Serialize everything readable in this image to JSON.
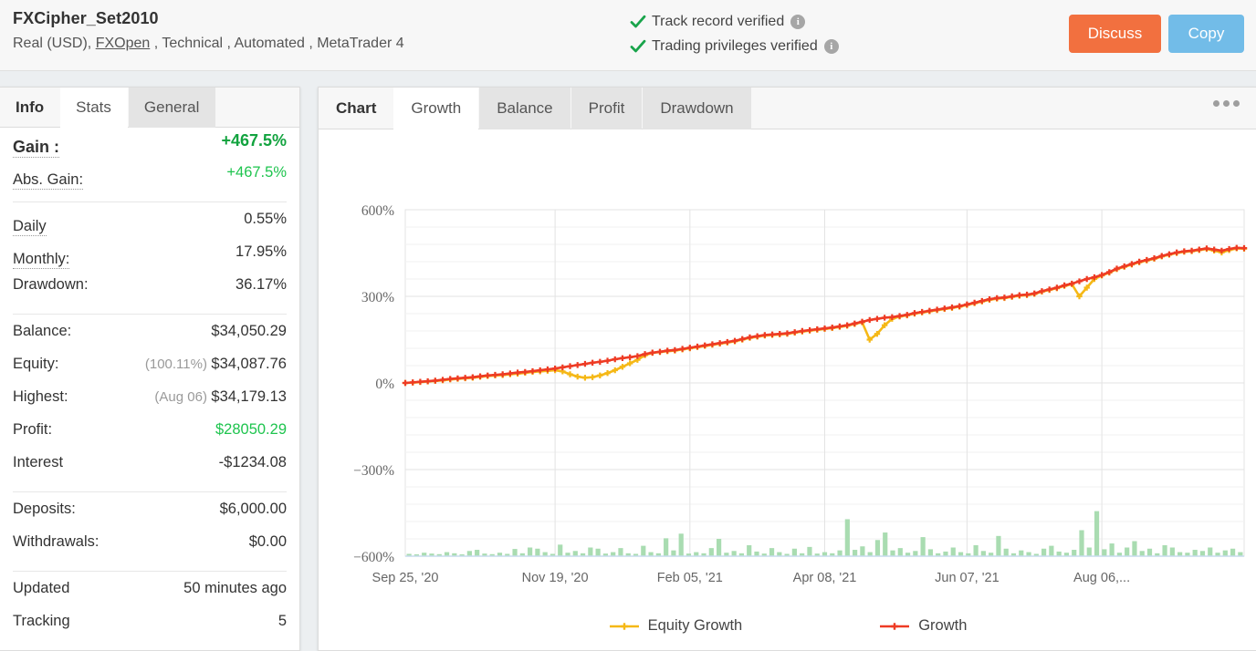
{
  "header": {
    "account_name": "FXCipher_Set2010",
    "subtitle_prefix": "Real (USD), ",
    "broker_link": "FXOpen",
    "subtitle_suffix": " , Technical , Automated , MetaTrader 4",
    "verification": [
      {
        "label": "Track record verified",
        "icon": "check-icon",
        "info": "i"
      },
      {
        "label": "Trading privileges verified",
        "icon": "check-icon",
        "info": "i"
      }
    ],
    "discuss_label": "Discuss",
    "copy_label": "Copy",
    "discuss_color": "#f2703f",
    "copy_color": "#72bce8"
  },
  "sidebar": {
    "tabs": [
      {
        "label": "Info",
        "state": "first"
      },
      {
        "label": "Stats",
        "state": "active"
      },
      {
        "label": "General",
        "state": "alt"
      }
    ],
    "groups": [
      {
        "rows": [
          {
            "label": "Gain :",
            "value": "+467.5%",
            "dotted": true,
            "bold": true,
            "value_class": "green"
          },
          {
            "label": "Abs. Gain:",
            "value": "+467.5%",
            "dotted": true,
            "bold": false,
            "value_class": "green-l"
          }
        ]
      },
      {
        "rows": [
          {
            "label": "Daily",
            "value": "0.55%",
            "dotted": true
          },
          {
            "label": "Monthly:",
            "value": "17.95%",
            "dotted": true
          },
          {
            "label": "Drawdown:",
            "value": "36.17%",
            "dotted": false
          }
        ]
      },
      {
        "rows": [
          {
            "label": "Balance:",
            "value": "$34,050.29",
            "dotted": false
          },
          {
            "label": "Equity:",
            "value": "$34,087.76",
            "prefix": "(100.11%)",
            "dotted": false
          },
          {
            "label": "Highest:",
            "value": "$34,179.13",
            "prefix": "(Aug 06)",
            "dotted": false
          },
          {
            "label": "Profit:",
            "value": "$28050.29",
            "dotted": false,
            "value_class": "green-l"
          },
          {
            "label": "Interest",
            "value": "-$1234.08",
            "dotted": false
          }
        ]
      },
      {
        "rows": [
          {
            "label": "Deposits:",
            "value": "$6,000.00",
            "dotted": false
          },
          {
            "label": "Withdrawals:",
            "value": "$0.00",
            "dotted": false
          }
        ]
      },
      {
        "rows": [
          {
            "label": "Updated",
            "value": "50 minutes ago",
            "dotted": false
          },
          {
            "label": "Tracking",
            "value": "5",
            "dotted": false
          }
        ]
      }
    ]
  },
  "chart_panel": {
    "tabs": [
      {
        "label": "Chart",
        "state": "first"
      },
      {
        "label": "Growth",
        "state": "active"
      },
      {
        "label": "Balance",
        "state": "alt"
      },
      {
        "label": "Profit",
        "state": "alt"
      },
      {
        "label": "Drawdown",
        "state": "alt"
      }
    ],
    "menu_icon": "ellipsis-icon"
  },
  "chart_data": {
    "type": "line",
    "title": "",
    "xlabel": "",
    "ylabel": "",
    "ylim": [
      -600,
      600
    ],
    "ytick_labels": [
      "600%",
      "300%",
      "0%",
      "−300%",
      "−600%"
    ],
    "yticks": [
      600,
      300,
      0,
      -300,
      -600
    ],
    "minor_tick_step": 60,
    "grid": true,
    "legend_position": "bottom",
    "xtick_labels": [
      "Sep 25, '20",
      "Nov 19, '20",
      "Feb 05, '21",
      "Apr 08, '21",
      "Jun 07, '21",
      "Aug 06,..."
    ],
    "xticks_index": [
      0,
      20,
      38,
      56,
      75,
      93
    ],
    "series": [
      {
        "name": "Growth",
        "color": "#ee3b24",
        "marker": "plus",
        "values": [
          0,
          2,
          4,
          6,
          8,
          11,
          14,
          16,
          18,
          20,
          23,
          26,
          28,
          30,
          33,
          36,
          38,
          41,
          44,
          47,
          50,
          54,
          58,
          62,
          66,
          70,
          73,
          77,
          82,
          86,
          89,
          93,
          100,
          105,
          108,
          112,
          114,
          118,
          122,
          126,
          130,
          134,
          138,
          142,
          146,
          152,
          158,
          162,
          166,
          168,
          170,
          172,
          176,
          180,
          183,
          186,
          189,
          192,
          196,
          200,
          206,
          212,
          218,
          222,
          226,
          228,
          232,
          236,
          242,
          246,
          250,
          254,
          258,
          262,
          266,
          272,
          278,
          284,
          290,
          294,
          296,
          300,
          304,
          306,
          310,
          318,
          324,
          330,
          338,
          344,
          352,
          360,
          366,
          374,
          384,
          396,
          404,
          412,
          420,
          426,
          432,
          440,
          446,
          452,
          456,
          458,
          462,
          466,
          462,
          458,
          464,
          468,
          467
        ]
      },
      {
        "name": "Equity Growth",
        "color": "#f5b816",
        "marker": "plus",
        "values": [
          0,
          1,
          3,
          5,
          7,
          9,
          12,
          14,
          16,
          18,
          21,
          24,
          26,
          27,
          30,
          32,
          35,
          38,
          40,
          42,
          44,
          40,
          30,
          22,
          18,
          20,
          26,
          34,
          44,
          56,
          68,
          80,
          96,
          104,
          107,
          110,
          112,
          116,
          120,
          124,
          128,
          132,
          136,
          140,
          144,
          150,
          156,
          160,
          164,
          166,
          168,
          170,
          174,
          178,
          181,
          184,
          187,
          190,
          194,
          198,
          204,
          210,
          150,
          170,
          200,
          222,
          230,
          234,
          240,
          244,
          248,
          252,
          256,
          260,
          264,
          270,
          276,
          282,
          288,
          292,
          294,
          298,
          302,
          304,
          308,
          316,
          322,
          328,
          336,
          342,
          300,
          330,
          360,
          372,
          382,
          394,
          402,
          410,
          418,
          424,
          430,
          438,
          444,
          450,
          454,
          456,
          460,
          464,
          458,
          452,
          460,
          466,
          465
        ]
      }
    ],
    "bars": {
      "name": "Drawdown bars",
      "color": "#a9dcb1",
      "baseline": -600,
      "values": [
        8,
        6,
        12,
        9,
        7,
        14,
        10,
        6,
        18,
        22,
        9,
        7,
        12,
        8,
        25,
        10,
        30,
        26,
        14,
        8,
        40,
        12,
        18,
        10,
        30,
        26,
        9,
        14,
        28,
        10,
        8,
        36,
        14,
        10,
        62,
        20,
        78,
        9,
        14,
        10,
        28,
        60,
        12,
        18,
        10,
        38,
        16,
        9,
        28,
        14,
        8,
        26,
        10,
        32,
        9,
        14,
        10,
        20,
        128,
        22,
        34,
        14,
        56,
        82,
        20,
        28,
        12,
        18,
        66,
        24,
        10,
        16,
        30,
        14,
        10,
        38,
        18,
        12,
        70,
        26,
        10,
        20,
        14,
        8,
        26,
        36,
        16,
        12,
        22,
        90,
        30,
        156,
        24,
        44,
        12,
        30,
        52,
        18,
        26,
        10,
        38,
        30,
        14,
        12,
        22,
        18,
        30,
        12,
        20,
        26,
        14
      ]
    }
  }
}
